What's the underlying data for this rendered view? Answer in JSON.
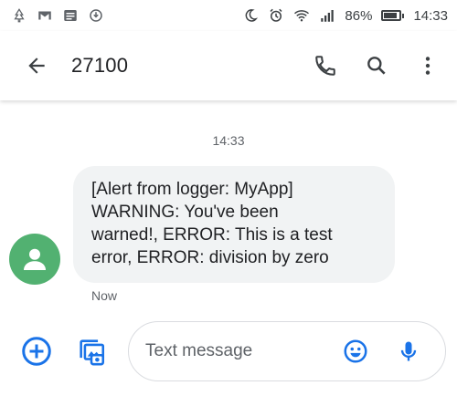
{
  "status_bar": {
    "battery": "86%",
    "time": "14:33",
    "icons_left": [
      "tree-icon",
      "gmail-icon",
      "news-icon",
      "shield-icon"
    ],
    "icons_right": [
      "dnd-moon-icon",
      "alarm-icon",
      "wifi-icon",
      "signal-icon",
      "battery-icon"
    ]
  },
  "app_bar": {
    "title": "27100",
    "icons": [
      "back-arrow-icon",
      "phone-icon",
      "search-icon",
      "more-vert-icon"
    ]
  },
  "conversation": {
    "timestamp": "14:33",
    "message": {
      "lines": [
        "[Alert from logger: MyApp]",
        "WARNING: You've been",
        "warned!, ERROR: This is a test",
        "error, ERROR: division by zero"
      ],
      "meta": "Now"
    }
  },
  "compose": {
    "placeholder": "Text message",
    "value": "",
    "icons": [
      "add-circle-icon",
      "gallery-icon",
      "emoji-icon",
      "mic-icon"
    ]
  },
  "colors": {
    "accent": "#1a73e8",
    "avatar": "#52b171",
    "bubble": "#f1f3f4"
  }
}
